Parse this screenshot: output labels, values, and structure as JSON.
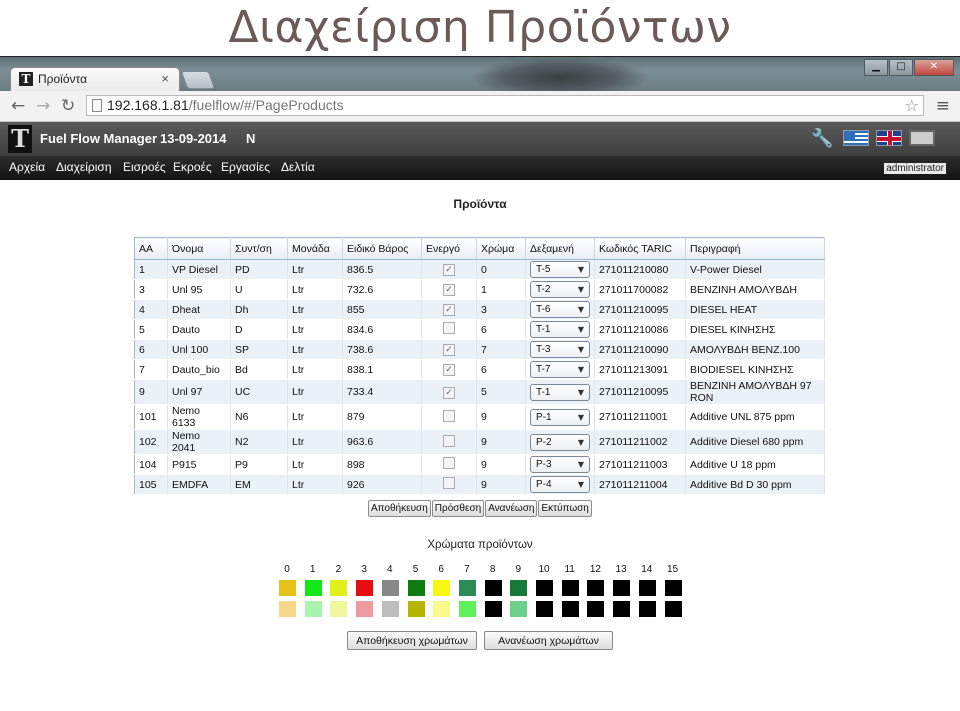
{
  "slide_title": "Διαχείριση Προϊόντων",
  "browser": {
    "tab_title": "Προϊόντα",
    "tab_close": "×",
    "url_host": "192.168.1.81",
    "url_path": "/fuelflow/#/PageProducts",
    "win_min": "▁",
    "win_max": "□",
    "win_close": "✕",
    "back": "←",
    "forward": "→",
    "reload": "↻",
    "bookmark": "☆",
    "menu": "≡"
  },
  "app": {
    "logo": "T",
    "title": "Fuel Flow Manager",
    "date": "13-09-2014",
    "status": "N",
    "user": "administrator",
    "wrench": "🔧"
  },
  "menu": [
    "Αρχεία",
    "Διαχείριση",
    "Εισροές",
    "Εκροές",
    "Εργασίες",
    "Δελτία"
  ],
  "page_heading": "Προϊόντα",
  "table": {
    "headers": [
      "ΑΑ",
      "Όνομα",
      "Συντ/ση",
      "Μονάδα",
      "Ειδικό Βάρος",
      "Ενεργό",
      "Χρώμα",
      "Δεξαμενή",
      "Κωδικός TARIC",
      "Περιγραφή"
    ],
    "rows": [
      {
        "aa": "1",
        "name": "VP Diesel",
        "abbr": "PD",
        "unit": "Ltr",
        "weight": "836.5",
        "active": true,
        "color": "0",
        "tank": "T-5",
        "taric": "271011210080",
        "desc": "V-Power Diesel"
      },
      {
        "aa": "3",
        "name": "Unl 95",
        "abbr": "U",
        "unit": "Ltr",
        "weight": "732.6",
        "active": true,
        "color": "1",
        "tank": "T-2",
        "taric": "271011700082",
        "desc": "ΒΕΝΖΙΝΗ ΑΜΟΛΥΒΔΗ"
      },
      {
        "aa": "4",
        "name": "Dheat",
        "abbr": "Dh",
        "unit": "Ltr",
        "weight": "855",
        "active": true,
        "color": "3",
        "tank": "T-6",
        "taric": "271011210095",
        "desc": "DIESEL HEAT"
      },
      {
        "aa": "5",
        "name": "Dauto",
        "abbr": "D",
        "unit": "Ltr",
        "weight": "834.6",
        "active": false,
        "color": "6",
        "tank": "T-1",
        "taric": "271011210086",
        "desc": "DIESEL ΚΙΝΗΣΗΣ"
      },
      {
        "aa": "6",
        "name": "Unl 100",
        "abbr": "SP",
        "unit": "Ltr",
        "weight": "738.6",
        "active": true,
        "color": "7",
        "tank": "T-3",
        "taric": "271011210090",
        "desc": "ΑΜΟΛΥΒΔΗ ΒΕΝΖ.100"
      },
      {
        "aa": "7",
        "name": "Dauto_bio",
        "abbr": "Bd",
        "unit": "Ltr",
        "weight": "838.1",
        "active": true,
        "color": "6",
        "tank": "T-7",
        "taric": "271011213091",
        "desc": "BIODIESEL ΚΙΝΗΣΗΣ"
      },
      {
        "aa": "9",
        "name": "Unl 97",
        "abbr": "UC",
        "unit": "Ltr",
        "weight": "733.4",
        "active": true,
        "color": "5",
        "tank": "T-1",
        "taric": "271011210095",
        "desc": "ΒΕΝΖΙΝΗ ΑΜΟΛΥΒΔΗ 97 RON"
      },
      {
        "aa": "101",
        "name": "Nemo 6133",
        "abbr": "N6",
        "unit": "Ltr",
        "weight": "879",
        "active": false,
        "color": "9",
        "tank": "P-1",
        "taric": "271011211001",
        "desc": "Additive UNL 875 ppm"
      },
      {
        "aa": "102",
        "name": "Nemo 2041",
        "abbr": "N2",
        "unit": "Ltr",
        "weight": "963.6",
        "active": false,
        "color": "9",
        "tank": "P-2",
        "taric": "271011211002",
        "desc": "Additive Diesel 680 ppm"
      },
      {
        "aa": "104",
        "name": "P915",
        "abbr": "P9",
        "unit": "Ltr",
        "weight": "898",
        "active": false,
        "color": "9",
        "tank": "P-3",
        "taric": "271011211003",
        "desc": "Additive U 18 ppm"
      },
      {
        "aa": "105",
        "name": "EMDFA",
        "abbr": "EM",
        "unit": "Ltr",
        "weight": "926",
        "active": false,
        "color": "9",
        "tank": "P-4",
        "taric": "271011211004",
        "desc": "Additive Bd D 30 ppm"
      }
    ]
  },
  "actions": [
    "Αποθήκευση",
    "Πρόσθεση",
    "Ανανέωση",
    "Εκτύπωση"
  ],
  "colors": {
    "title": "Χρώματα προϊόντων",
    "numbers": [
      "0",
      "1",
      "2",
      "3",
      "4",
      "5",
      "6",
      "7",
      "8",
      "9",
      "10",
      "11",
      "12",
      "13",
      "14",
      "15"
    ],
    "primary": [
      "#e6c21a",
      "#14e61a",
      "#e0f01a",
      "#e60e0e",
      "#888888",
      "#0f7a0f",
      "#f7f714",
      "#2e8b57",
      "#000000",
      "#157a3c",
      "#000000",
      "#000000",
      "#000000",
      "#000000",
      "#000000",
      "#000000"
    ],
    "secondary": [
      "#f5d98a",
      "#a9f5b0",
      "#eef79a",
      "#ef9aa0",
      "#bdbdbd",
      "#b5b500",
      "#fafa8c",
      "#5ef05e",
      "#000000",
      "#6ccf8a",
      "#000000",
      "#000000",
      "#000000",
      "#000000",
      "#000000",
      "#000000"
    ],
    "save_label": "Αποθήκευση χρωμάτων",
    "refresh_label": "Ανανέωση χρωμάτων"
  }
}
